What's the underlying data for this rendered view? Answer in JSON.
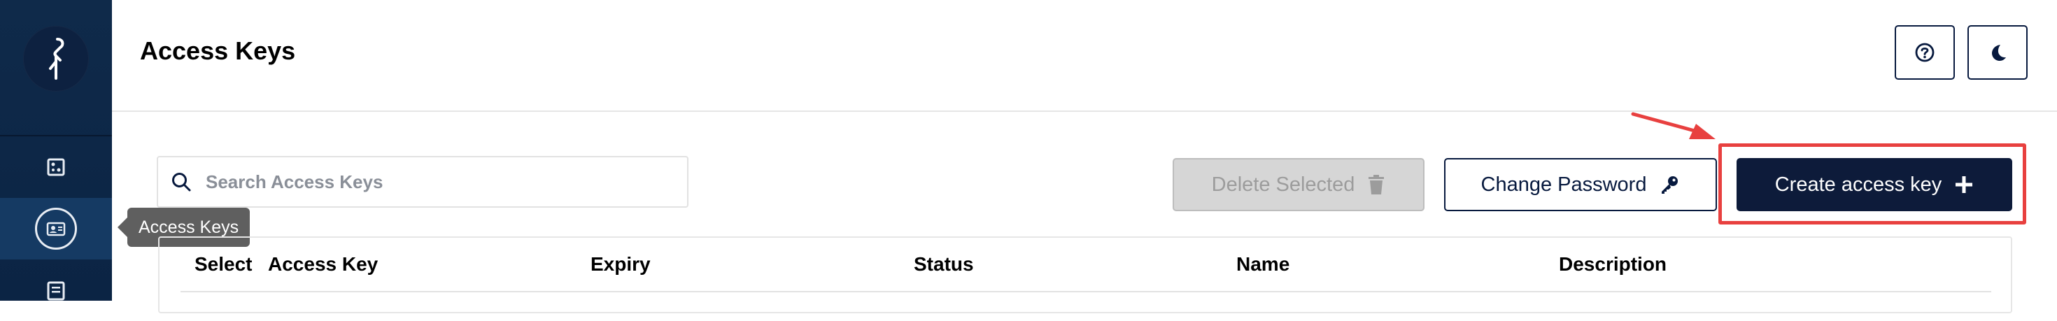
{
  "header": {
    "title": "Access Keys",
    "help_icon": "help-circle-icon",
    "theme_icon": "moon-icon"
  },
  "sidebar": {
    "logo_icon": "minio-bird-icon",
    "items": [
      {
        "icon": "bucket-icon",
        "active": false
      },
      {
        "icon": "access-keys-icon",
        "active": true
      },
      {
        "icon": "documentation-icon",
        "active": false
      }
    ],
    "tooltip": "Access Keys"
  },
  "toolbar": {
    "search_placeholder": "Search Access Keys",
    "delete_label": "Delete Selected",
    "change_password_label": "Change Password",
    "create_label": "Create access key"
  },
  "table": {
    "columns": [
      "Select",
      "Access Key",
      "Expiry",
      "Status",
      "Name",
      "Description"
    ]
  },
  "colors": {
    "sidebar": "#0f2a4a",
    "primary": "#0d1b3a",
    "highlight": "#e8403f",
    "disabled": "#d6d6d6"
  }
}
